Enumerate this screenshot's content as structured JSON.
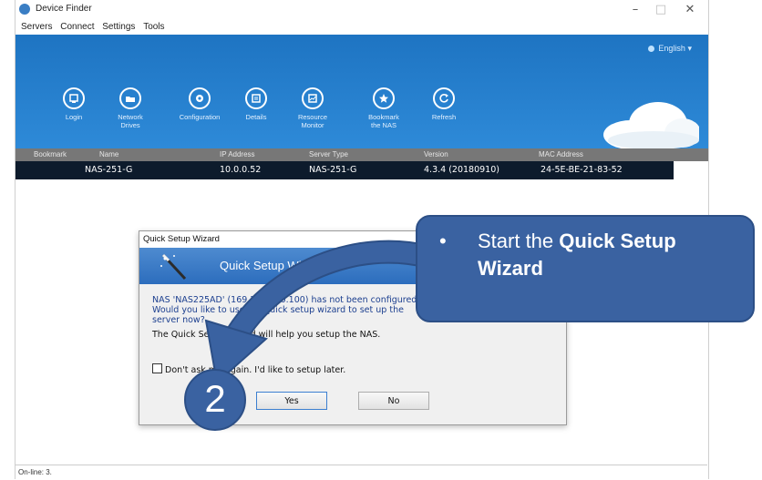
{
  "window": {
    "title": "Device Finder",
    "controls": {
      "minimize": "–",
      "maximize": "□",
      "close": "✕"
    }
  },
  "menu": [
    "Servers",
    "Connect",
    "Settings",
    "Tools"
  ],
  "banner": {
    "language": "English",
    "language_arrow": "▾",
    "tools": [
      {
        "label": "Login",
        "icon": "login-icon"
      },
      {
        "label": "Network\nDrives",
        "icon": "network-drives-icon"
      },
      {
        "label": "Configuration",
        "icon": "configuration-icon"
      },
      {
        "label": "Details",
        "icon": "details-icon"
      },
      {
        "label": "Resource\nMonitor",
        "icon": "resource-monitor-icon"
      },
      {
        "label": "Bookmark\nthe NAS",
        "icon": "bookmark-icon"
      },
      {
        "label": "Refresh",
        "icon": "refresh-icon"
      }
    ]
  },
  "table": {
    "columns": [
      "Bookmark",
      "Name",
      "IP Address",
      "Server Type",
      "Version",
      "MAC Address"
    ],
    "rows": [
      {
        "name": "NAS-251-G",
        "ip": "10.0.0.52",
        "type": "NAS-251-G",
        "version": "4.3.4 (20180910)",
        "mac": "24-5E-BE-21-83-52"
      }
    ]
  },
  "status": "On-line: 3.",
  "dialog": {
    "title": "Quick Setup Wizard",
    "header": "Quick Setup Wizard",
    "message": "NAS 'NAS225AD' (169.254.100.100) has not been configured. Would you like to use the quick setup wizard to set up the server now?",
    "help": "The Quick Setup Wizard will help you setup the NAS.",
    "checkbox": "Don't ask me again. I'd like to setup later.",
    "yes": "Yes",
    "no": "No"
  },
  "callout": {
    "bullet": "•",
    "prefix": "Start the ",
    "bold": "Quick Setup Wizard"
  },
  "step_number": "2",
  "colors": {
    "banner": "#2e8ad8",
    "callout": "#3a62a1",
    "row": "#0d1b2c"
  }
}
